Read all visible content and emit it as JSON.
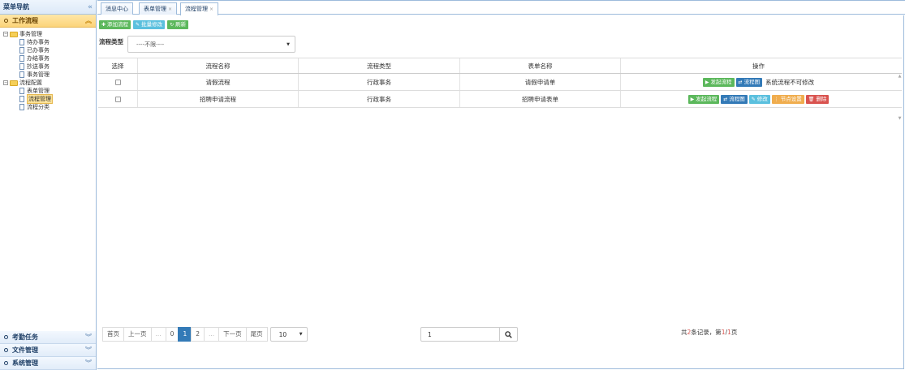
{
  "sidebar": {
    "title": "菜单导航",
    "collapse_icon": "«",
    "panels": [
      {
        "label": "工作流程",
        "icon": "bullet-icon",
        "active": true
      }
    ],
    "tree": {
      "groups": [
        {
          "label": "事务管理",
          "items": [
            "待办事务",
            "已办事务",
            "办结事务",
            "抄送事务",
            "事务管理"
          ]
        },
        {
          "label": "流程配置",
          "items": [
            "表单管理",
            "流程管理",
            "流程分类"
          ]
        }
      ],
      "selected": "流程管理"
    },
    "bottom_panels": [
      "考勤任务",
      "文件管理",
      "系统管理"
    ]
  },
  "tabs": [
    {
      "label": "消息中心",
      "closable": false
    },
    {
      "label": "表单管理",
      "closable": true
    },
    {
      "label": "流程管理",
      "closable": true,
      "active": true
    }
  ],
  "toolbar": {
    "add_label": "添加流程",
    "batch_label": "批量修改",
    "refresh_label": "刷新"
  },
  "filter": {
    "label": "流程类型",
    "value": "----不限----"
  },
  "table": {
    "columns": [
      "选择",
      "流程名称",
      "流程类型",
      "表单名称",
      "操作"
    ],
    "rows": [
      {
        "name": "请假流程",
        "type": "行政事务",
        "form": "请假申请单",
        "note": "系统流程不可修改"
      },
      {
        "name": "招聘申请流程",
        "type": "行政事务",
        "form": "招聘申请表单",
        "note": ""
      }
    ],
    "actions": {
      "start": "发起流程",
      "chart": "流程图",
      "edit": "修改",
      "nodes": "节点设置",
      "delete": "删除"
    }
  },
  "pager": {
    "first": "首页",
    "prev": "上一页",
    "ellipsis": "...",
    "pages": [
      "0",
      "1",
      "2"
    ],
    "current": "1",
    "next": "下一页",
    "last": "尾页",
    "page_size": "10",
    "jump_value": "1",
    "summary_prefix": "共",
    "total": "2",
    "summary_mid": "条记录，第",
    "page_cur": "1",
    "slash": "/",
    "page_total": "1",
    "summary_suffix": "页"
  },
  "colors": {
    "green": "#5cb85c",
    "cyan": "#5bc0de",
    "blue": "#337ab7",
    "orange": "#f0ad4e",
    "red": "#d9534f",
    "active_panel": "#fcd47a"
  }
}
